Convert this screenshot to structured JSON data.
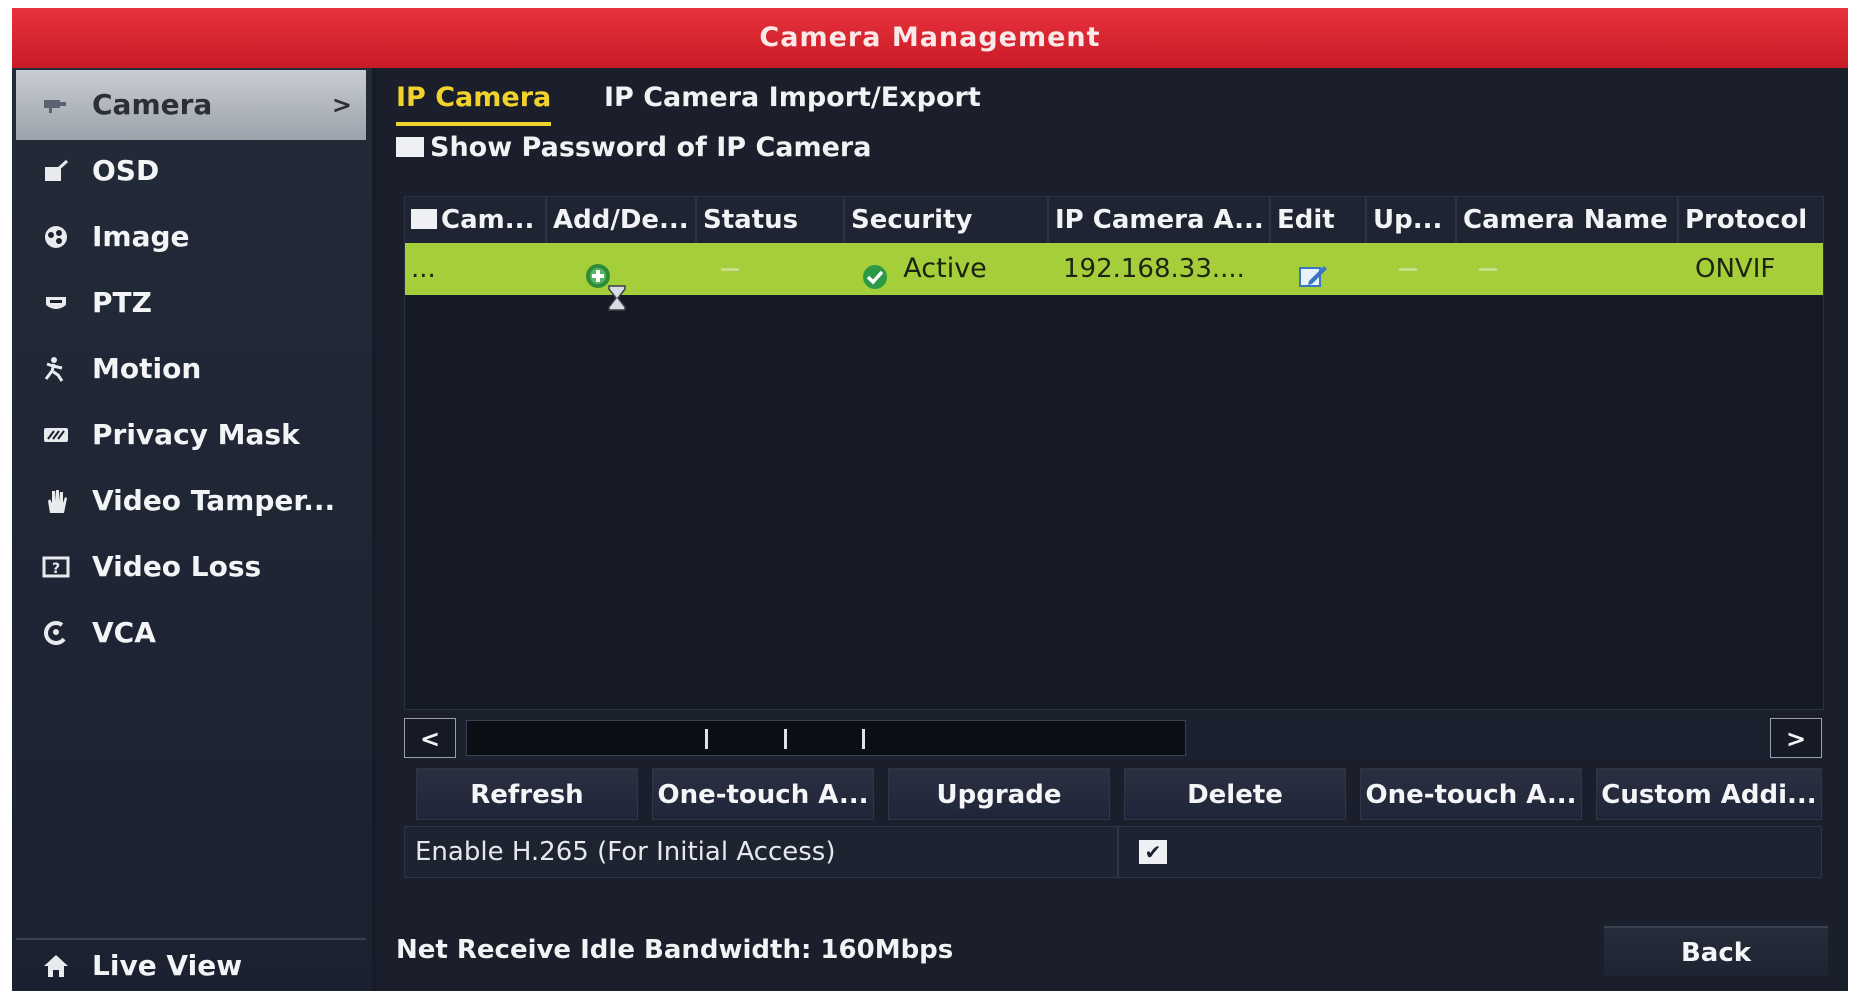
{
  "window": {
    "title": "Camera Management"
  },
  "sidebar": {
    "items": [
      {
        "label": "Camera",
        "icon": "camera-icon",
        "active": true,
        "chevron": ">"
      },
      {
        "label": "OSD",
        "icon": "osd-icon"
      },
      {
        "label": "Image",
        "icon": "image-icon"
      },
      {
        "label": "PTZ",
        "icon": "ptz-icon"
      },
      {
        "label": "Motion",
        "icon": "motion-icon"
      },
      {
        "label": "Privacy Mask",
        "icon": "privacy-mask-icon"
      },
      {
        "label": "Video Tamper...",
        "icon": "video-tamper-icon"
      },
      {
        "label": "Video Loss",
        "icon": "video-loss-icon"
      },
      {
        "label": "VCA",
        "icon": "vca-icon"
      }
    ],
    "live_view": {
      "label": "Live View",
      "icon": "home-icon"
    }
  },
  "tabs": [
    {
      "label": "IP Camera",
      "active": true
    },
    {
      "label": "IP Camera Import/Export"
    }
  ],
  "show_password": {
    "label": "Show Password of IP Camera",
    "checked": false
  },
  "table": {
    "columns": [
      "Cam...",
      "Add/De...",
      "Status",
      "Security",
      "IP Camera A...",
      "Edit",
      "Up...",
      "Camera Name",
      "Protocol"
    ],
    "rows": [
      {
        "camera": "...",
        "add_delete": "add-icon",
        "status": "-",
        "security_icon": "check-circle-icon",
        "security": "Active",
        "ip_address": "192.168.33....",
        "edit": "edit-icon",
        "upgrade": "-",
        "camera_name": "-",
        "protocol": "ONVIF"
      }
    ]
  },
  "scrollbar": {
    "left": "<",
    "right": ">"
  },
  "actions": [
    "Refresh",
    "One-touch A...",
    "Upgrade",
    "Delete",
    "One-touch A...",
    "Custom Addi..."
  ],
  "h265": {
    "label": "Enable H.265 (For Initial Access)",
    "checked": true,
    "check_mark": "✔"
  },
  "footer": {
    "bandwidth": "Net Receive Idle Bandwidth: 160Mbps",
    "back": "Back"
  },
  "colors": {
    "title_bar": "#d8222c",
    "active_tab": "#f2d22c",
    "selected_row": "#a5cf3a"
  }
}
